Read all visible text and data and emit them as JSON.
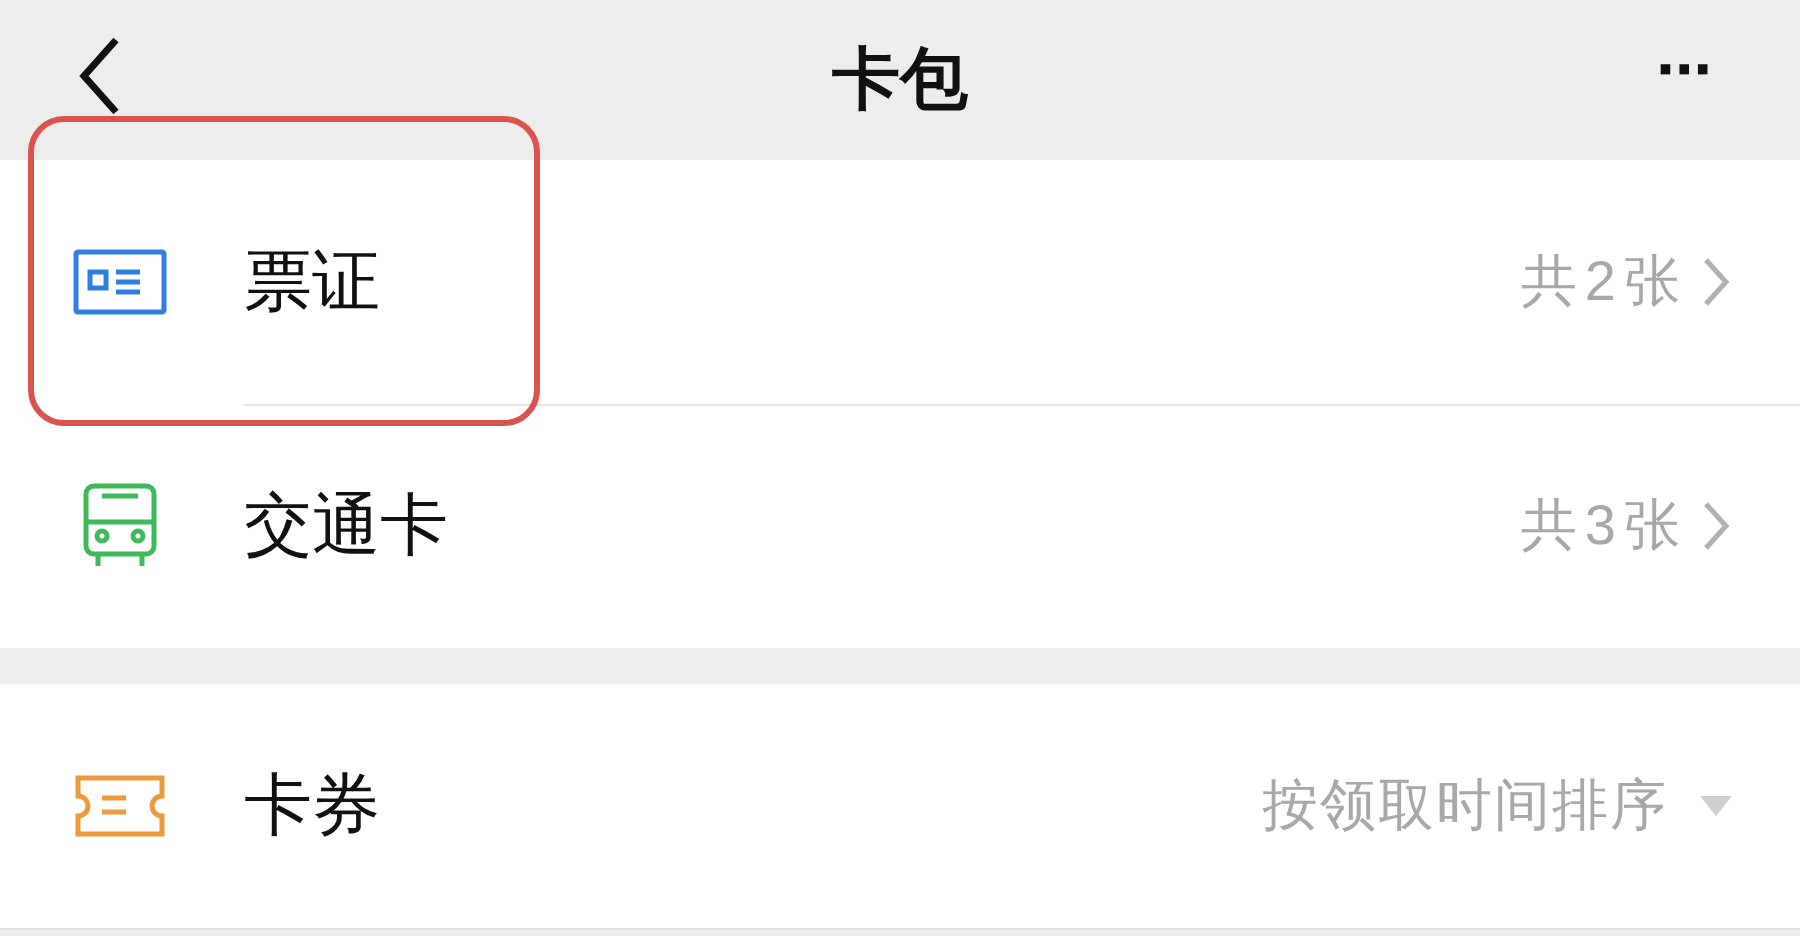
{
  "header": {
    "title": "卡包",
    "more": "···"
  },
  "sections": [
    {
      "items": [
        {
          "kind": "ticket",
          "label": "票证",
          "detail": "共2张",
          "highlighted": true
        },
        {
          "kind": "transit",
          "label": "交通卡",
          "detail": "共3张",
          "highlighted": false
        }
      ]
    },
    {
      "items": [
        {
          "kind": "coupon",
          "label": "卡券",
          "sort": "按领取时间排序",
          "highlighted": false
        }
      ]
    }
  ]
}
